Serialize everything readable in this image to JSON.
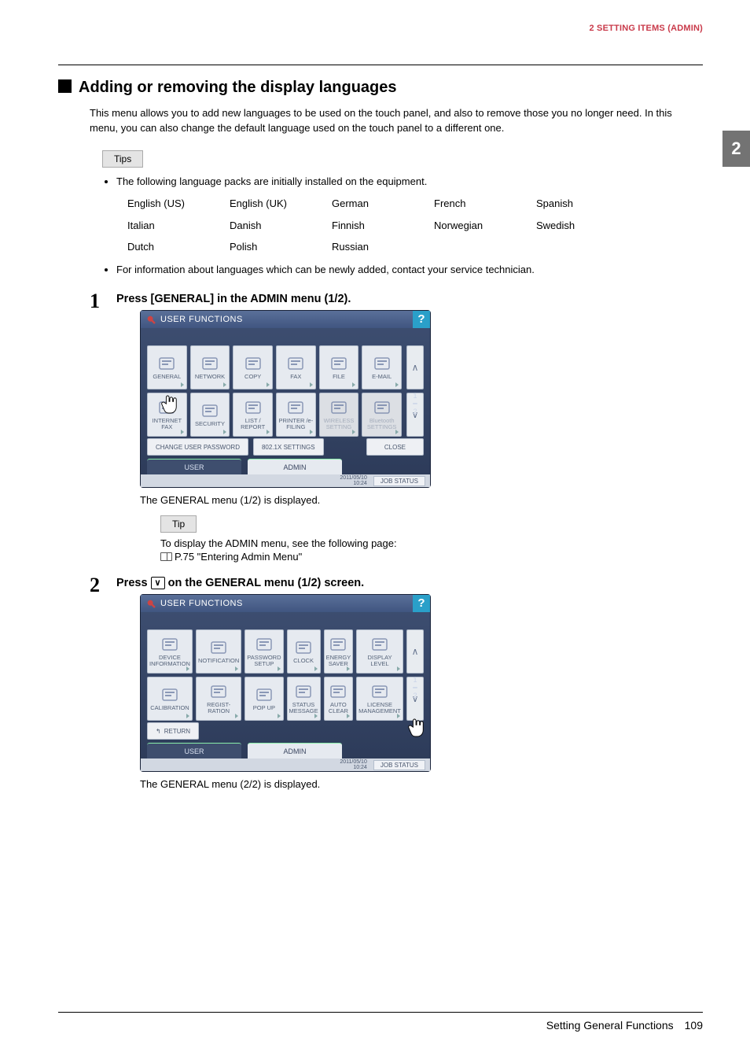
{
  "header": {
    "chapter": "2 SETTING ITEMS (ADMIN)",
    "sideTab": "2"
  },
  "h2": "Adding or removing the display languages",
  "intro": "This menu allows you to add new languages to be used on the touch panel, and also to remove those you no longer need. In this menu, you can also change the default language used on the touch panel to a different one.",
  "tipsLabel": "Tips",
  "tipsBullet1": "The following language packs are initially installed on the equipment.",
  "languages": [
    [
      "English (US)",
      "English (UK)",
      "German",
      "French",
      "Spanish"
    ],
    [
      "Italian",
      "Danish",
      "Finnish",
      "Norwegian",
      "Swedish"
    ],
    [
      "Dutch",
      "Polish",
      "Russian",
      "",
      ""
    ]
  ],
  "tipsBullet2": "For information about languages which can be newly added, contact your service technician.",
  "step1": {
    "num": "1",
    "title": "Press [GENERAL] in the ADMIN menu (1/2).",
    "after": "The GENERAL menu (1/2) is displayed."
  },
  "panelCommon": {
    "title": "USER FUNCTIONS",
    "help": "?",
    "pageTop": "1",
    "pageBot": "2",
    "tabUser": "USER",
    "tabAdmin": "ADMIN",
    "timestamp1": "2011/05/10",
    "timestamp2": "10:24",
    "jobStatus": "JOB STATUS"
  },
  "panel1": {
    "cells": [
      "GENERAL",
      "NETWORK",
      "COPY",
      "FAX",
      "FILE",
      "E-MAIL",
      "INTERNET FAX",
      "SECURITY",
      "LIST / REPORT",
      "PRINTER /e-FILING",
      "WIRELESS SETTING",
      "Bluetooth SETTINGS"
    ],
    "dim": [
      10,
      11
    ],
    "bottom": {
      "changePwd": "CHANGE USER PASSWORD",
      "dot1x": "802.1X SETTINGS",
      "close": "CLOSE"
    }
  },
  "tipSingle": {
    "label": "Tip",
    "line": "To display the ADMIN menu, see the following page:",
    "ref": "P.75 \"Entering Admin Menu\""
  },
  "step2": {
    "num": "2",
    "titlePre": "Press ",
    "titlePost": " on the GENERAL menu (1/2) screen.",
    "after": "The GENERAL menu (2/2) is displayed."
  },
  "panel2": {
    "cells": [
      "DEVICE INFORMATION",
      "NOTIFICATION",
      "PASSWORD SETUP",
      "CLOCK",
      "ENERGY SAVER",
      "DISPLAY LEVEL",
      "CALIBRATION",
      "REGIST-RATION",
      "POP UP",
      "STATUS MESSAGE",
      "AUTO CLEAR",
      "LICENSE MANAGEMENT"
    ],
    "return": "RETURN"
  },
  "footer": {
    "title": "Setting General Functions",
    "page": "109"
  }
}
